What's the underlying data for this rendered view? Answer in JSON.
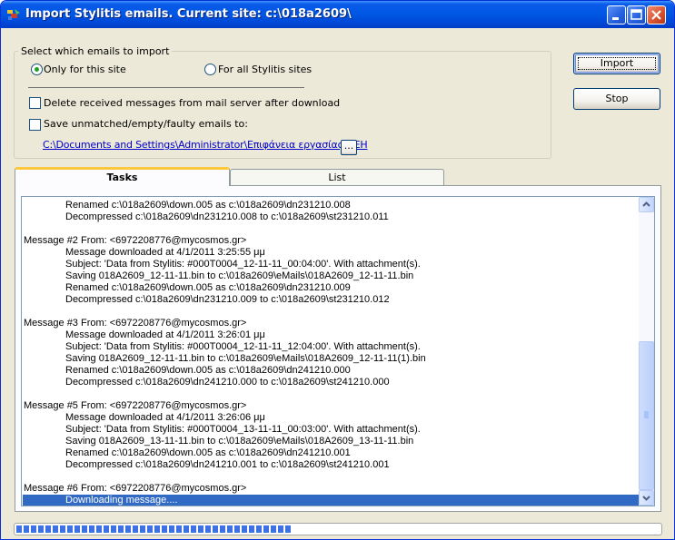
{
  "window": {
    "title": "Import Stylitis emails. Current site: c:\\018a2609\\"
  },
  "selection": {
    "legend": "Select which emails to import",
    "option_site": "Only for this site",
    "option_all": "For all Stylitis sites",
    "selected": "site",
    "delete_label": "Delete received messages from mail server after download",
    "delete_checked": false,
    "save_label": "Save unmatched/empty/faulty emails to:",
    "save_checked": false,
    "save_path": "C:\\Documents and Settings\\Administrator\\Επιφάνεια εργασίας\\DEH",
    "browse_label": "..."
  },
  "buttons": {
    "import": "Import",
    "stop": "Stop"
  },
  "tabs": [
    {
      "label": "Tasks",
      "active": true
    },
    {
      "label": "List",
      "active": false
    }
  ],
  "log": [
    {
      "indent": true,
      "text": "Renamed c:\\018a2609\\down.005 as c:\\018a2609\\dn231210.008"
    },
    {
      "indent": true,
      "text": "Decompressed c:\\018a2609\\dn231210.008 to c:\\018a2609\\st231210.011"
    },
    {
      "indent": false,
      "text": ""
    },
    {
      "indent": false,
      "text": "Message #2 From: <6972208776@mycosmos.gr>"
    },
    {
      "indent": true,
      "text": "Message downloaded at 4/1/2011 3:25:55 μμ"
    },
    {
      "indent": true,
      "text": "Subject: 'Data from Stylitis: #000T0004_12-11-11_00:04:00'. With attachment(s)."
    },
    {
      "indent": true,
      "text": "Saving 018A2609_12-11-11.bin to c:\\018a2609\\eMails\\018A2609_12-11-11.bin"
    },
    {
      "indent": true,
      "text": "Renamed c:\\018a2609\\down.005 as c:\\018a2609\\dn231210.009"
    },
    {
      "indent": true,
      "text": "Decompressed c:\\018a2609\\dn231210.009 to c:\\018a2609\\st231210.012"
    },
    {
      "indent": false,
      "text": ""
    },
    {
      "indent": false,
      "text": "Message #3 From: <6972208776@mycosmos.gr>"
    },
    {
      "indent": true,
      "text": "Message downloaded at 4/1/2011 3:26:01 μμ"
    },
    {
      "indent": true,
      "text": "Subject: 'Data from Stylitis: #000T0004_12-11-11_12:04:00'. With attachment(s)."
    },
    {
      "indent": true,
      "text": "Saving 018A2609_12-11-11.bin to c:\\018a2609\\eMails\\018A2609_12-11-11(1).bin"
    },
    {
      "indent": true,
      "text": "Renamed c:\\018a2609\\down.005 as c:\\018a2609\\dn241210.000"
    },
    {
      "indent": true,
      "text": "Decompressed c:\\018a2609\\dn241210.000 to c:\\018a2609\\st241210.000"
    },
    {
      "indent": false,
      "text": ""
    },
    {
      "indent": false,
      "text": "Message #5 From: <6972208776@mycosmos.gr>"
    },
    {
      "indent": true,
      "text": "Message downloaded at 4/1/2011 3:26:06 μμ"
    },
    {
      "indent": true,
      "text": "Subject: 'Data from Stylitis: #000T0004_13-11-11_00:03:00'. With attachment(s)."
    },
    {
      "indent": true,
      "text": "Saving 018A2609_13-11-11.bin to c:\\018a2609\\eMails\\018A2609_13-11-11.bin"
    },
    {
      "indent": true,
      "text": "Renamed c:\\018a2609\\down.005 as c:\\018a2609\\dn241210.001"
    },
    {
      "indent": true,
      "text": "Decompressed c:\\018a2609\\dn241210.001 to c:\\018a2609\\st241210.001"
    },
    {
      "indent": false,
      "text": ""
    },
    {
      "indent": false,
      "text": "Message #6 From: <6972208776@mycosmos.gr>"
    },
    {
      "indent": true,
      "text": "Downloading message....",
      "selected": true
    }
  ],
  "progress": {
    "fraction": 0.43
  },
  "colors": {
    "titlebar": "#0058E4",
    "selection": "#316AC5",
    "link": "#0000CC",
    "progress": "#3C72E6"
  }
}
